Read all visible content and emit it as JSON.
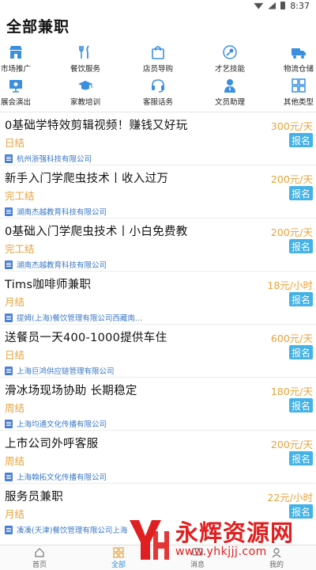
{
  "status": {
    "time": "8:37"
  },
  "header": {
    "title": "全部兼职"
  },
  "categories": [
    {
      "label": "市场推广",
      "icon": "storefront-icon",
      "color": "#3a8fe0"
    },
    {
      "label": "餐饮服务",
      "icon": "utensils-icon",
      "color": "#3a8fe0"
    },
    {
      "label": "店员导购",
      "icon": "shopping-bag-icon",
      "color": "#3a8fe0"
    },
    {
      "label": "才艺技能",
      "icon": "microphone-icon",
      "color": "#3a8fe0"
    },
    {
      "label": "物流仓储",
      "icon": "truck-icon",
      "color": "#3a8fe0"
    },
    {
      "label": "展会演出",
      "icon": "presentation-icon",
      "color": "#3a8fe0"
    },
    {
      "label": "家教培训",
      "icon": "graduation-cap-icon",
      "color": "#3a8fe0"
    },
    {
      "label": "客服话务",
      "icon": "headset-icon",
      "color": "#3a8fe0"
    },
    {
      "label": "文员助理",
      "icon": "person-icon",
      "color": "#3a8fe0"
    },
    {
      "label": "其他类型",
      "icon": "grid-icon",
      "color": "#3a8fe0"
    }
  ],
  "jobs": [
    {
      "title": "0基础学特效剪辑视频！赚钱又好玩",
      "salary": "300元/天",
      "settle": "日结",
      "company": "杭州浙强科技有限公司",
      "apply": "报名"
    },
    {
      "title": "新手入门学爬虫技术丨收入过万",
      "salary": "200元/天",
      "settle": "完工结",
      "company": "湖南杰越教育科技有限公司",
      "apply": "报名"
    },
    {
      "title": "0基础入门学爬虫技术丨小白免费教",
      "salary": "200元/天",
      "settle": "完工结",
      "company": "湖南杰越教育科技有限公司",
      "apply": "报名"
    },
    {
      "title": "Tims咖啡师兼职",
      "salary": "18元/小时",
      "settle": "月结",
      "company": "提姆(上海)餐饮管理有限公司西藏南...",
      "apply": "报名"
    },
    {
      "title": "送餐员一天400-1000提供车住",
      "salary": "600元/天",
      "settle": "日结",
      "company": "上海巨鸿供应链管理有限公司",
      "apply": "报名"
    },
    {
      "title": "滑冰场现场协助 长期稳定",
      "salary": "180元/天",
      "settle": "周结",
      "company": "上海均通文化传播有限公司",
      "apply": "报名"
    },
    {
      "title": "上市公司外呼客服",
      "salary": "200元/天",
      "settle": "周结",
      "company": "上海翰拓文化传播有限公司",
      "apply": "报名"
    },
    {
      "title": "服务员兼职",
      "salary": "22元/小时",
      "settle": "月结",
      "company": "凑凑(天津)餐饮管理有限公司上海",
      "apply": "报名"
    }
  ],
  "tabbar": [
    {
      "label": "首页",
      "icon": "home-icon"
    },
    {
      "label": "全部",
      "icon": "grid-icon"
    },
    {
      "label": "消息",
      "icon": "message-icon"
    },
    {
      "label": "我的",
      "icon": "user-icon"
    }
  ],
  "watermark": {
    "brand": "永辉资源网",
    "url": "www.yhkjjj.com"
  }
}
